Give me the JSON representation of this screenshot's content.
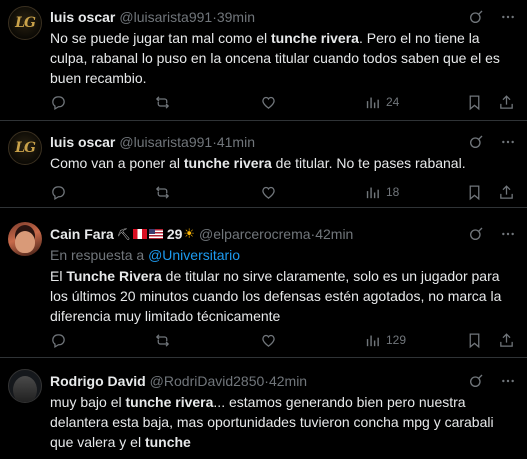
{
  "tweets": [
    {
      "name": "luis oscar",
      "handle": "@luisarista991",
      "time": "39min",
      "avatar": "LG",
      "body": [
        {
          "t": "No se puede jugar tan mal como el ",
          "b": false
        },
        {
          "t": "tunche rivera",
          "b": true
        },
        {
          "t": ". Pero el no tiene la culpa, rabanal lo puso en la oncena titular cuando todos saben que el es buen recambio.",
          "b": false
        }
      ],
      "views": "24"
    },
    {
      "name": "luis oscar",
      "handle": "@luisarista991",
      "time": "41min",
      "avatar": "LG",
      "body": [
        {
          "t": "Como van a poner al ",
          "b": false
        },
        {
          "t": "tunche rivera",
          "b": true
        },
        {
          "t": " de titular. No te pases rabanal.",
          "b": false
        }
      ],
      "views": "18"
    },
    {
      "name": "Cain Fara",
      "emoji_suffix": "29",
      "handle": "@elparcerocrema",
      "time": "42min",
      "reply_prefix": "En respuesta a ",
      "reply_to": "@Universitario",
      "body": [
        {
          "t": "El ",
          "b": false
        },
        {
          "t": "Tunche Rivera",
          "b": true
        },
        {
          "t": " de titular no sirve claramente, solo es un jugador para los últimos 20 minutos cuando los defensas estén agotados, no marca la diferencia muy limitado técnicamente",
          "b": false
        }
      ],
      "views": "129"
    },
    {
      "name": "Rodrigo David",
      "handle": "@RodriDavid2850",
      "time": "42min",
      "body": [
        {
          "t": "muy bajo el ",
          "b": false
        },
        {
          "t": "tunche rivera",
          "b": true
        },
        {
          "t": "... estamos generando bien pero nuestra delantera esta baja, mas oportunidades tuvieron concha mpg y carabali que valera y el ",
          "b": false
        },
        {
          "t": "tunche",
          "b": true
        }
      ]
    }
  ],
  "separator": " · ",
  "icons": {
    "grok": "grok-icon",
    "more": "more-icon",
    "reply": "reply-icon",
    "retweet": "retweet-icon",
    "like": "like-icon",
    "views": "views-icon",
    "bookmark": "bookmark-icon",
    "share": "share-icon"
  },
  "colors": {
    "background": "#000000",
    "text": "#e7e9ea",
    "muted": "#71767b",
    "link": "#1d9bf0",
    "divider": "#2f3336"
  }
}
